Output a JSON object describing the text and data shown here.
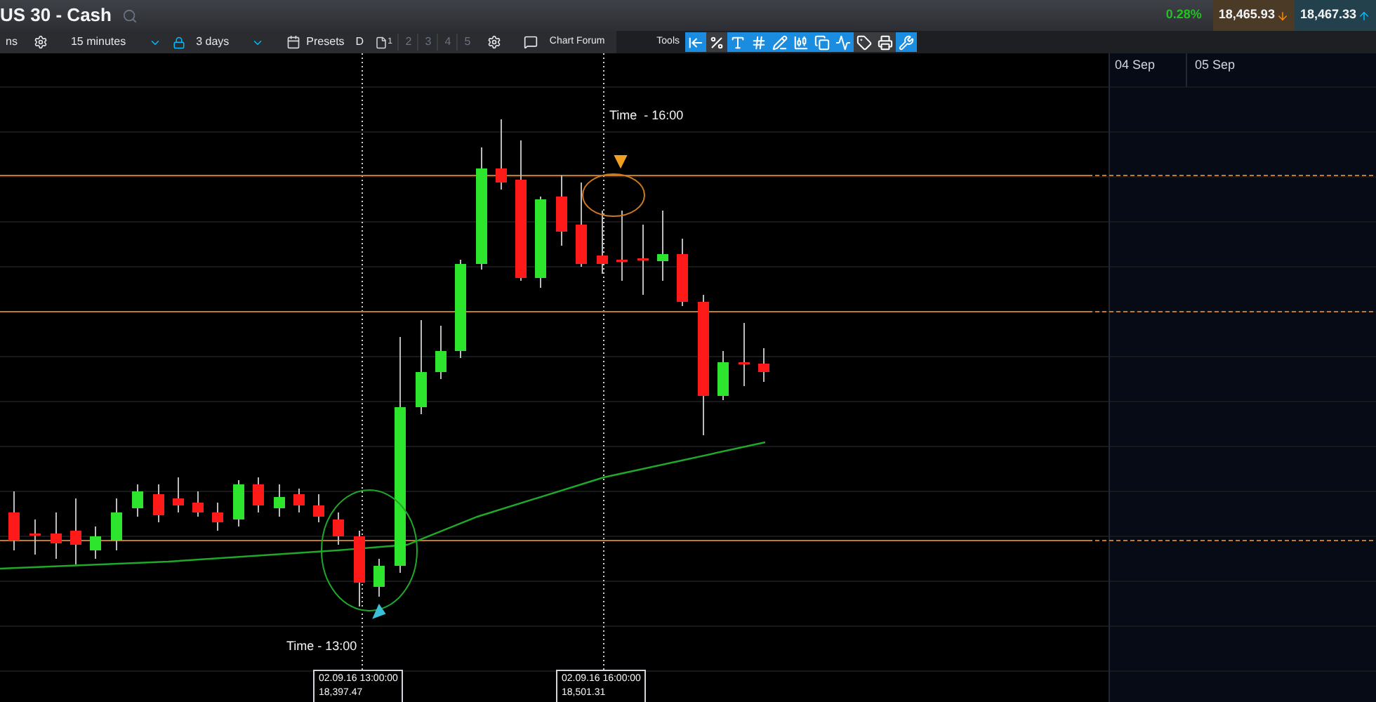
{
  "header": {
    "title": "US 30 - Cash",
    "change": "0.28%",
    "sell": "18,465.93",
    "buy": "18,467.33"
  },
  "toolbar": {
    "items": [
      {
        "kind": "label",
        "text": "ns"
      },
      {
        "kind": "gear"
      },
      {
        "kind": "dropdown",
        "text": "15 minutes"
      },
      {
        "kind": "lock"
      },
      {
        "kind": "dropdown",
        "text": "3 days"
      },
      {
        "kind": "calendar"
      },
      {
        "kind": "label",
        "text": "Presets"
      },
      {
        "kind": "label",
        "text": "D"
      },
      {
        "kind": "page",
        "text": "1"
      },
      {
        "kind": "number",
        "text": "2",
        "disabled": true
      },
      {
        "kind": "number",
        "text": "3",
        "disabled": true
      },
      {
        "kind": "number",
        "text": "4",
        "disabled": true
      },
      {
        "kind": "number",
        "text": "5",
        "disabled": true
      },
      {
        "kind": "gear"
      },
      {
        "kind": "chat",
        "text": "Chart Forum"
      }
    ],
    "tools_label": "Tools",
    "tools": [
      {
        "kind": "back",
        "selected": true
      },
      {
        "kind": "percent",
        "selected": false
      },
      {
        "kind": "text",
        "selected": true
      },
      {
        "kind": "grid",
        "selected": true
      },
      {
        "kind": "draw",
        "selected": true
      },
      {
        "kind": "candle",
        "selected": true
      },
      {
        "kind": "windows",
        "selected": true
      },
      {
        "kind": "indicator",
        "selected": true
      },
      {
        "kind": "tag",
        "selected": false
      },
      {
        "kind": "print",
        "selected": false
      },
      {
        "kind": "settings",
        "selected": true
      }
    ]
  },
  "chart": {
    "dates": [
      "04 Sep",
      "05 Sep"
    ],
    "annotations": [
      "Time  - 16:00",
      "Time - 13:00"
    ],
    "crosshairs": [
      {
        "datetime": "02.09.16 13:00:00",
        "price": "18,397.47"
      },
      {
        "datetime": "02.09.16 16:00:00",
        "price": "18,501.31"
      }
    ]
  }
}
